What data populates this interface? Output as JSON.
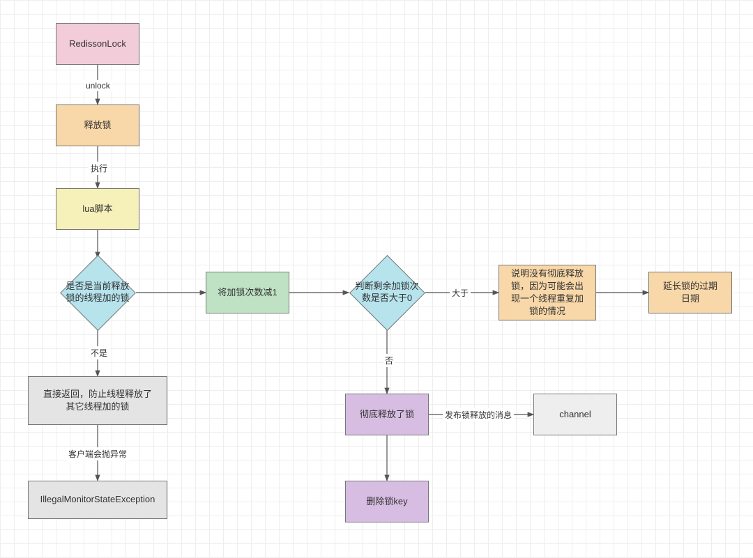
{
  "nodes": {
    "redisson_lock": {
      "label": "RedissonLock",
      "fill": "#f2ccd8"
    },
    "release_lock": {
      "label": "释放锁",
      "fill": "#f8d7a8"
    },
    "lua_script": {
      "label": "lua脚本",
      "fill": "#f6f0b9"
    },
    "is_current_thread": {
      "label": "是否是当前释放\n锁的线程加的锁",
      "fill": "#b6e3ec"
    },
    "decrement_count": {
      "label": "将加锁次数减1",
      "fill": "#bfe2c4"
    },
    "count_gt_zero": {
      "label": "判断剩余加锁次\n数是否大于0",
      "fill": "#b6e3ec"
    },
    "not_fully_released": {
      "label": "说明没有彻底释放\n锁，因为可能会出\n现一个线程重复加\n锁的情况",
      "fill": "#f8d7a8"
    },
    "extend_expiry": {
      "label": "延长锁的过期\n日期",
      "fill": "#f8d7a8"
    },
    "direct_return": {
      "label": "直接返回，防止线程释放了\n其它线程加的锁",
      "fill": "#e4e4e4"
    },
    "illegal_exception": {
      "label": "IllegalMonitorStateException",
      "fill": "#e4e4e4"
    },
    "fully_released": {
      "label": "彻底释放了锁",
      "fill": "#d7bde2"
    },
    "delete_key": {
      "label": "删除锁key",
      "fill": "#d7bde2"
    },
    "channel": {
      "label": "channel",
      "fill": "#eeeeee"
    }
  },
  "edges": {
    "e_unlock": {
      "label": "unlock"
    },
    "e_exec": {
      "label": "执行"
    },
    "e_not": {
      "label": "不是"
    },
    "e_gt": {
      "label": "大于"
    },
    "e_no_fully": {
      "label": "否"
    },
    "e_client_throw": {
      "label": "客户端会抛异常"
    },
    "e_publish": {
      "label": "发布锁释放的消息"
    }
  }
}
